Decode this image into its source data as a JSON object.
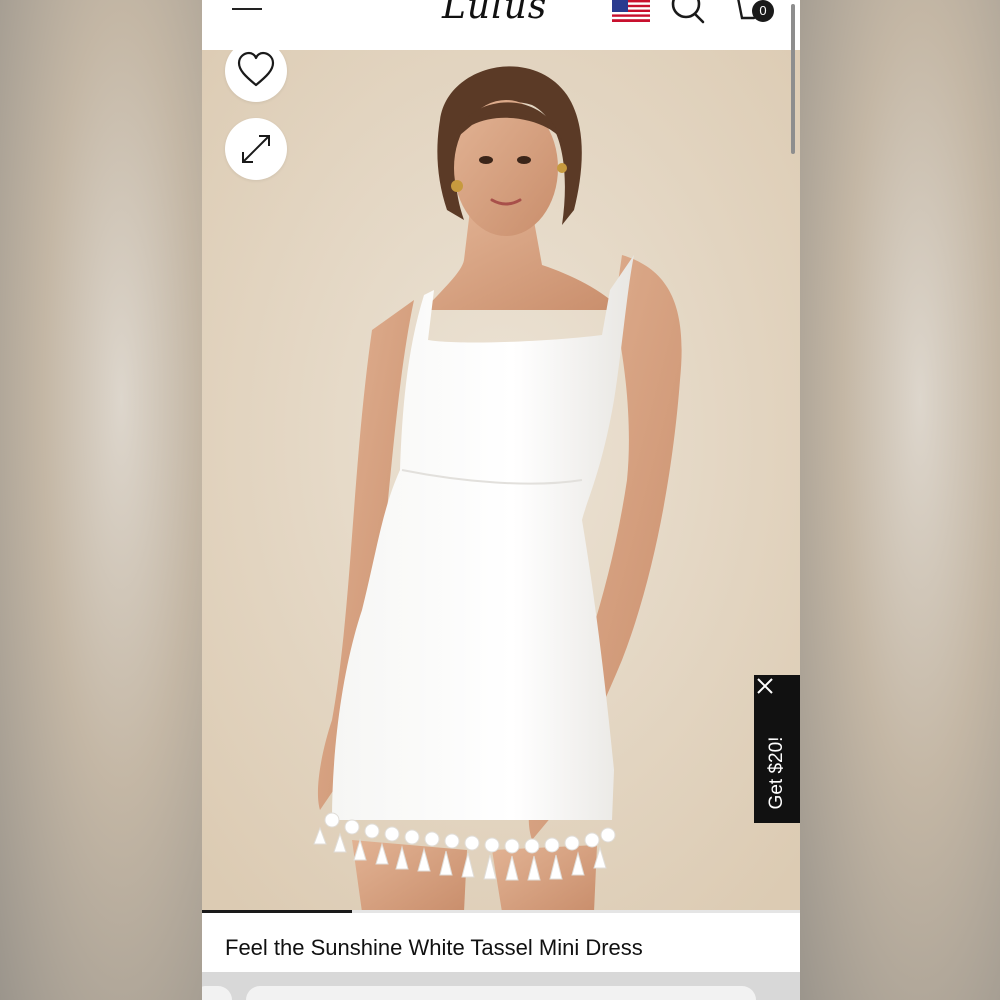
{
  "header": {
    "logo_text": "Lulus",
    "cart_count": "0",
    "icons": [
      "menu-icon",
      "us-flag-icon",
      "search-icon",
      "cart-icon"
    ]
  },
  "product": {
    "title": "Feel the Sunshine White Tassel Mini Dress",
    "image_gallery_progress": 0.25
  },
  "actions": {
    "wishlist_icon": "heart-outline-icon",
    "zoom_icon": "expand-arrows-icon"
  },
  "promo": {
    "label": "Get $20!",
    "close_icon": "close-icon",
    "background": "#111111"
  },
  "colors": {
    "accent": "#1a1a1a",
    "backdrop": "#e4d6c1",
    "dress": "#ffffff"
  }
}
